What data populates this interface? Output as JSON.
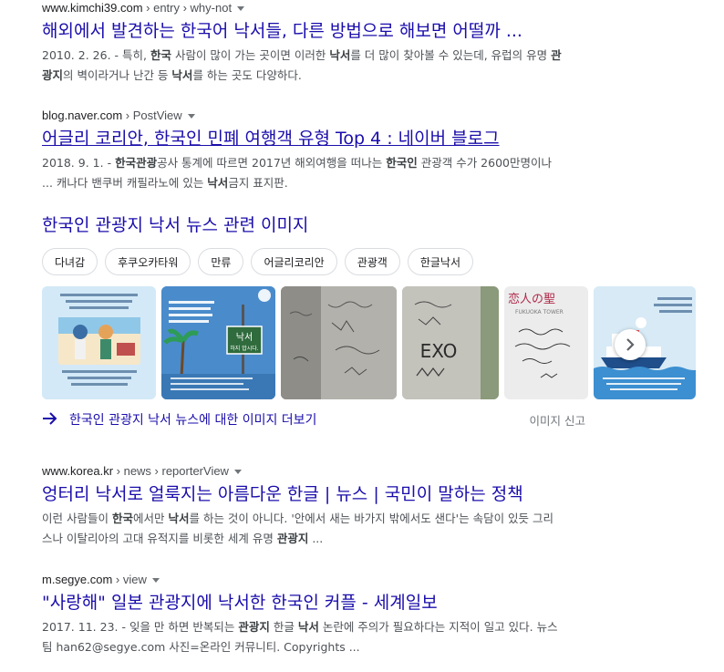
{
  "results": [
    {
      "cite_domain": "www.kimchi39.com",
      "cite_path": " › entry › why-not",
      "title": "해외에서 발견하는 한국어 낙서들, 다른 방법으로 해보면 어떨까 ...",
      "snippet_date": "2010. 2. 26.",
      "snippet_parts": [
        {
          "t": " - 특히, ",
          "b": false
        },
        {
          "t": "한국",
          "b": true
        },
        {
          "t": " 사람이 많이 가는 곳이면 이러한 ",
          "b": false
        },
        {
          "t": "낙서",
          "b": true
        },
        {
          "t": "를 더 많이 찾아볼 수 있는데, 유럽의 유명 ",
          "b": false
        },
        {
          "t": "관광지",
          "b": true
        },
        {
          "t": "의 벽이라거나 난간 등 ",
          "b": false
        },
        {
          "t": "낙서",
          "b": true
        },
        {
          "t": "를 하는 곳도 다양하다.",
          "b": false
        }
      ]
    },
    {
      "cite_domain": "blog.naver.com",
      "cite_path": " › PostView",
      "title": "어글리 코리안, 한국인 민폐 여행객 유형 Top 4 : 네이버 블로그",
      "snippet_date": "2018. 9. 1.",
      "snippet_parts": [
        {
          "t": " - ",
          "b": false
        },
        {
          "t": "한국관광",
          "b": true
        },
        {
          "t": "공사 통계에 따르면 2017년 해외여행을 떠나는 ",
          "b": false
        },
        {
          "t": "한국인",
          "b": true
        },
        {
          "t": " 관광객 수가 2600만명이나 ... 캐나다 밴쿠버 캐필라노에 있는 ",
          "b": false
        },
        {
          "t": "낙서",
          "b": true
        },
        {
          "t": "금지 표지판.",
          "b": false
        }
      ]
    },
    {
      "cite_domain": "www.korea.kr",
      "cite_path": " › news › reporterView",
      "title": "엉터리 낙서로 얼룩지는 아름다운 한글 | 뉴스 | 국민이 말하는 정책",
      "snippet_date": "",
      "snippet_parts": [
        {
          "t": "이런 사람들이 ",
          "b": false
        },
        {
          "t": "한국",
          "b": true
        },
        {
          "t": "에서만 ",
          "b": false
        },
        {
          "t": "낙서",
          "b": true
        },
        {
          "t": "를 하는 것이 아니다. '안에서 새는 바가지 밖에서도 샌다'는 속담이 있듯 그리스나 이탈리아의 고대 유적지를 비롯한 세계 유명 ",
          "b": false
        },
        {
          "t": "관광지",
          "b": true
        },
        {
          "t": " ...",
          "b": false
        }
      ]
    },
    {
      "cite_domain": "m.segye.com",
      "cite_path": " › view",
      "title": "\"사랑해\" 일본 관광지에 낙서한 한국인 커플 - 세계일보",
      "snippet_date": "2017. 11. 23.",
      "snippet_parts": [
        {
          "t": " - 잊을 만 하면 반복되는 ",
          "b": false
        },
        {
          "t": "관광지",
          "b": true
        },
        {
          "t": " 한글 ",
          "b": false
        },
        {
          "t": "낙서",
          "b": true
        },
        {
          "t": " 논란에 주의가 필요하다는 지적이 일고 있다. 뉴스팀 han62@segye.com 사진=온라인 커뮤니티. Copyrights ...",
          "b": false
        }
      ]
    }
  ],
  "images_section": {
    "heading": "한국인 관광지 낙서 뉴스 관련 이미지",
    "chips": [
      "다녀감",
      "후쿠오카타워",
      "만류",
      "어글리코리안",
      "관광객",
      "한글낙서"
    ],
    "thumb2_sign_line1": "낙서",
    "thumb2_sign_line2": "하지 맙시다.",
    "thumb5_heading": "恋人の聖",
    "thumb5_sub": "FUKUOKA TOWER",
    "thumb4_graffiti": "EXO",
    "more_link": "한국인 관광지 낙서 뉴스에 대한 이미지 더보기",
    "report": "이미지 신고"
  },
  "colors": {
    "link": "#1a0dab",
    "snippet": "#4d5156",
    "cite": "#202124",
    "chip_border": "#dadce0"
  }
}
